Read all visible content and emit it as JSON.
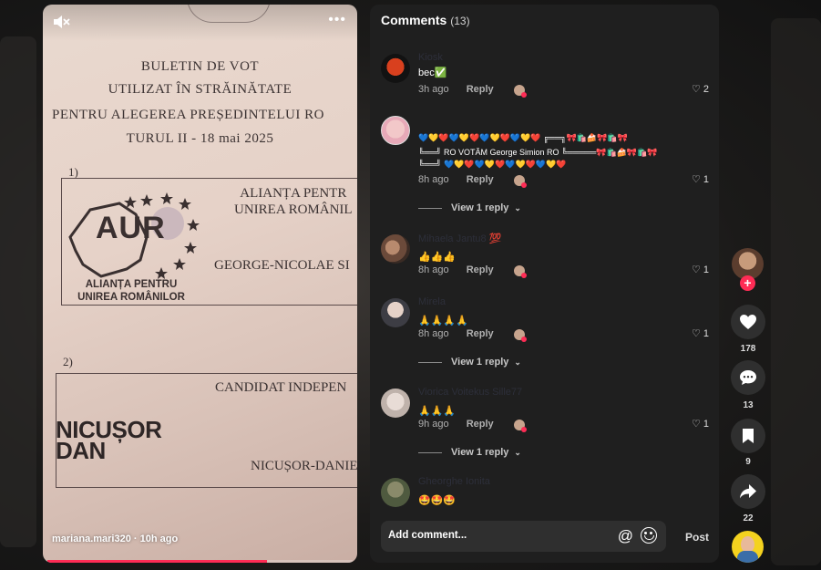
{
  "video": {
    "ballot": {
      "line1": "BULETIN DE VOT",
      "line2": "UTILIZAT ÎN STRĂINĂTATE",
      "line3": "PENTRU ALEGEREA PREȘEDINTELUI RO",
      "line4": "TURUL II - 18 mai 2025",
      "num1": "1)",
      "num2": "2)",
      "aur_logo": "AUR",
      "aur_sub": "ALIANȚA PENTRU\nUNIREA ROMÂNILOR",
      "party1_line1": "ALIANȚA PENTR",
      "party1_line2": "UNIREA ROMÂNIL",
      "candidate1": "GEORGE-NICOLAE SI",
      "indep": "CANDIDAT INDEPEN",
      "nd_logo_line1": "NICUȘOR",
      "nd_logo_line2": "DAN",
      "candidate2": "NICUȘOR-DANIEL"
    },
    "author_line": "mariana.mari320 · 10h ago",
    "more_label": "•••",
    "progress": 0.72
  },
  "comments_panel": {
    "title": "Comments",
    "count": "(13)",
    "comments": [
      {
        "name": "Kiosk",
        "text": "bec✅",
        "time": "3h ago",
        "reply": "Reply",
        "likes": "2"
      },
      {
        "name": "",
        "text_line1": "💙💛❤️💙💛❤️💙💛❤️💙💛❤️ ╔══╗🎀🛍️🍰🎀🛍️🎀",
        "text_line2": "╚══╝ RO VOTĂM George Simion RO ╚═════🎀🛍️🍰🎀🛍️🎀",
        "text_line3": "╚══╝ 💙💛❤️💙💛❤️💙💛❤️💙💛❤️",
        "time": "8h ago",
        "reply": "Reply",
        "likes": "1",
        "view_replies": "View 1 reply"
      },
      {
        "name": "Mihaela Jantu8 💯",
        "text": "👍👍👍",
        "time": "8h ago",
        "reply": "Reply",
        "likes": "1"
      },
      {
        "name": "Mirela",
        "text": "🙏🙏🙏🙏",
        "time": "8h ago",
        "reply": "Reply",
        "likes": "1",
        "view_replies": "View 1 reply"
      },
      {
        "name": "Viorica Voitekus Sille77",
        "text": "🙏🙏🙏",
        "time": "9h ago",
        "reply": "Reply",
        "likes": "1",
        "view_replies": "View 1 reply"
      },
      {
        "name": "Gheorghe Ionita",
        "text": "🤩🤩🤩"
      }
    ],
    "input_placeholder": "Add comment...",
    "at_symbol": "@",
    "post_label": "Post"
  },
  "rail": {
    "likes": "178",
    "comments": "13",
    "saves": "9",
    "shares": "22",
    "follow_symbol": "+"
  },
  "colors": {
    "accent": "#fe2c55",
    "panel_bg": "#1f1f1f"
  }
}
